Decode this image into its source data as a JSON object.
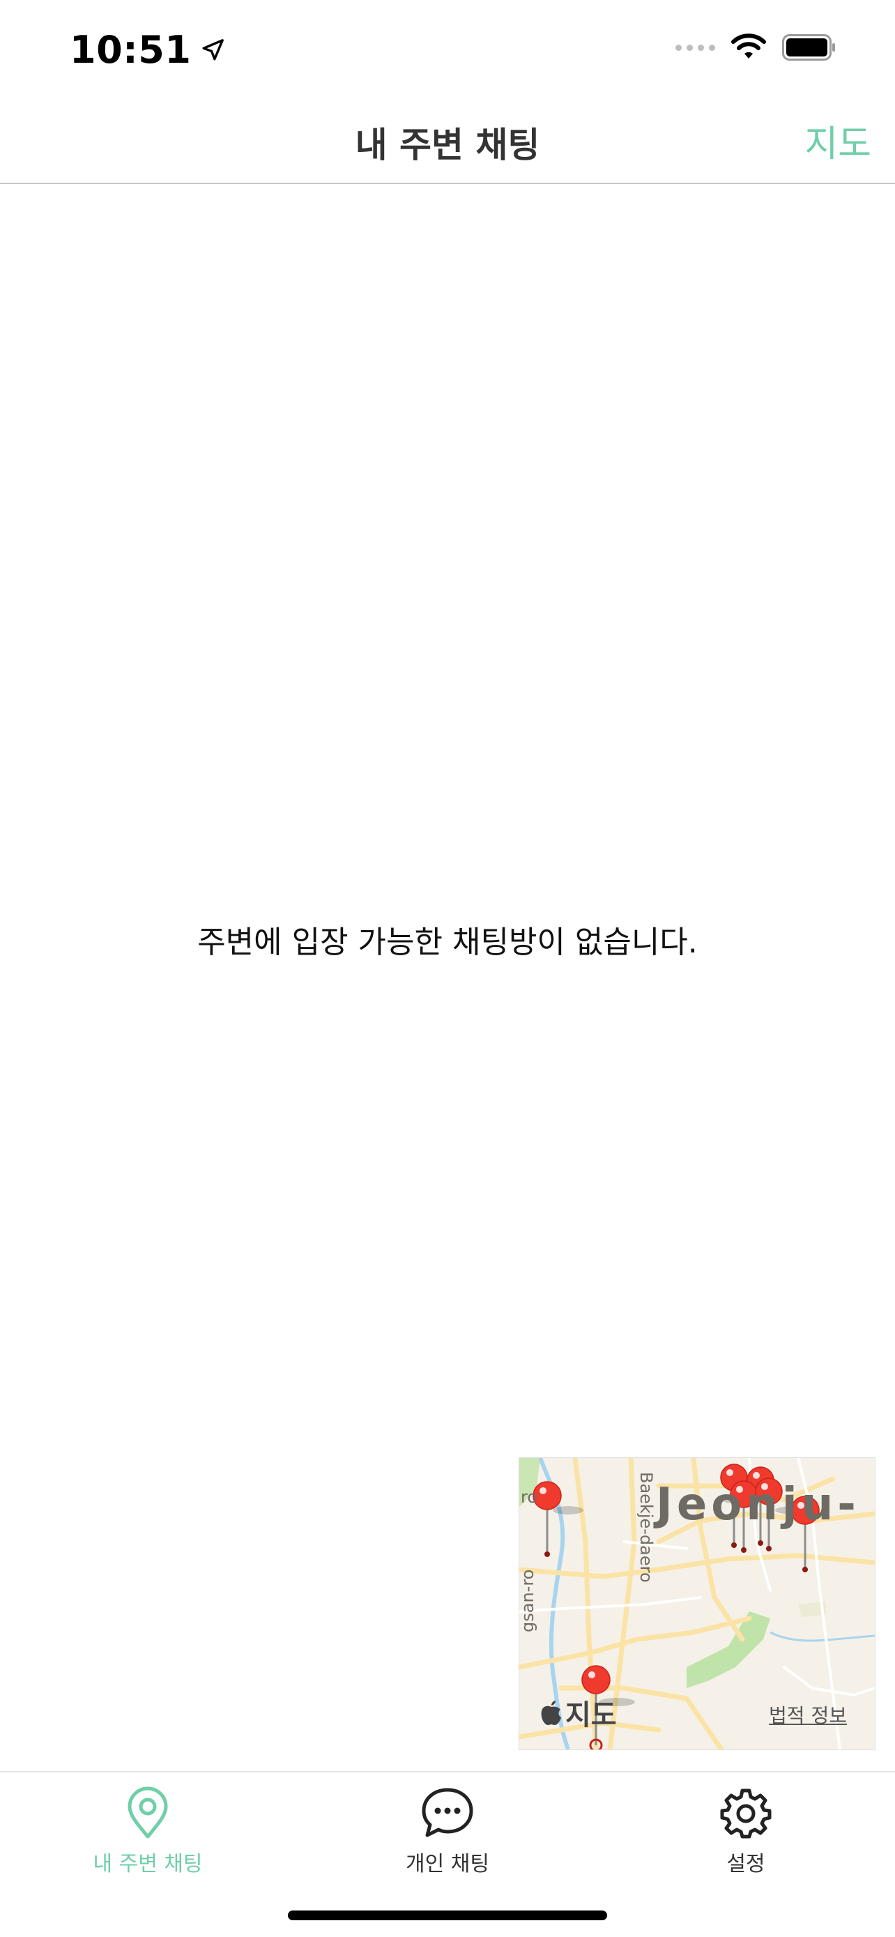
{
  "status_bar": {
    "time": "10:51"
  },
  "nav": {
    "title": "내 주변 채팅",
    "right_action": "지도"
  },
  "main": {
    "empty_message": "주변에 입장 가능한 채팅방이 없습니다."
  },
  "map_thumbnail": {
    "provider_label": "지도",
    "legal_label": "법적 정보",
    "city_label": "Jeonju-",
    "road_labels": [
      "Baekje-daero",
      "gsan-ro",
      "ro"
    ]
  },
  "tabs": [
    {
      "label": "내 주변 채팅",
      "icon": "location-pin-icon",
      "active": true
    },
    {
      "label": "개인 채팅",
      "icon": "chat-bubble-icon",
      "active": false
    },
    {
      "label": "설정",
      "icon": "gear-icon",
      "active": false
    }
  ],
  "colors": {
    "accent": "#6fcfa8",
    "pin": "#f03a2e",
    "map_background": "#f5f1e8",
    "map_road": "#fbe3a6",
    "map_park": "#bfe3a8"
  }
}
